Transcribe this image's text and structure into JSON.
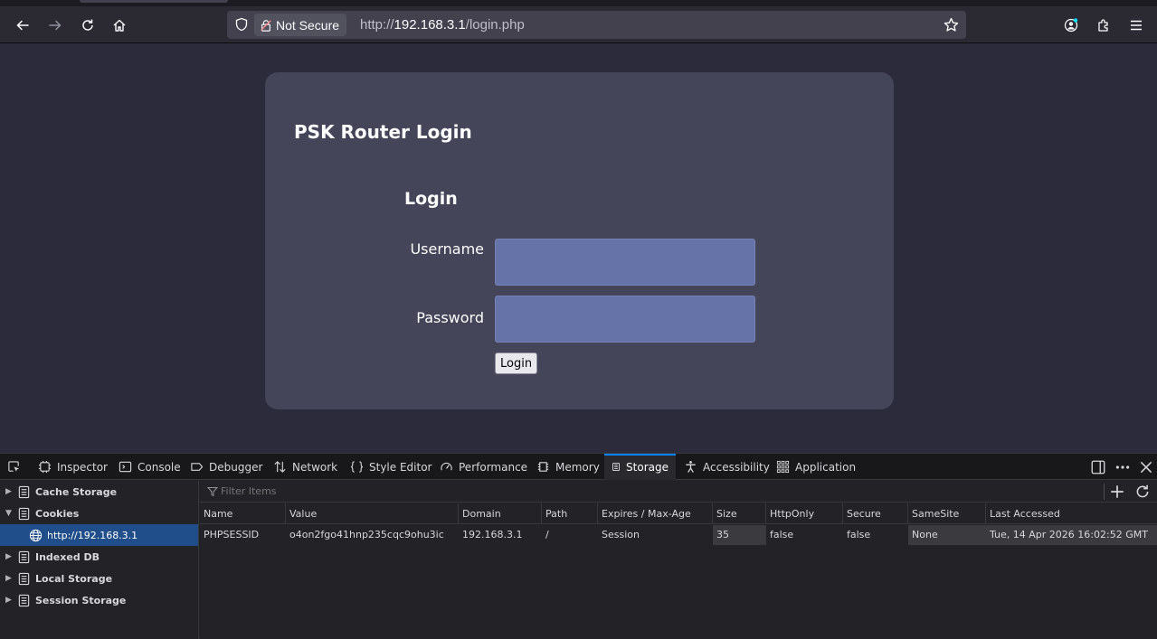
{
  "browser": {
    "security_label": "Not Secure",
    "url_prefix": "http://",
    "url_host": "192.168.3.1",
    "url_path": "/login.php"
  },
  "page": {
    "title": "PSK Router Login",
    "form_heading": "Login",
    "username_label": "Username",
    "password_label": "Password",
    "username_value": "",
    "password_value": "",
    "login_button": "Login"
  },
  "devtools": {
    "tabs": [
      "Inspector",
      "Console",
      "Debugger",
      "Network",
      "Style Editor",
      "Performance",
      "Memory",
      "Storage",
      "Accessibility",
      "Application"
    ],
    "selected_tab": "Storage",
    "sidebar": {
      "cache_storage": "Cache Storage",
      "cookies": "Cookies",
      "cookie_host": "http://192.168.3.1",
      "indexed_db": "Indexed DB",
      "local_storage": "Local Storage",
      "session_storage": "Session Storage"
    },
    "filter_placeholder": "Filter Items",
    "columns": [
      "Name",
      "Value",
      "Domain",
      "Path",
      "Expires / Max-Age",
      "Size",
      "HttpOnly",
      "Secure",
      "SameSite",
      "Last Accessed"
    ],
    "rows": [
      [
        "PHPSESSID",
        "o4on2fgo41hnp235cqc9ohu3ic",
        "192.168.3.1",
        "/",
        "Session",
        "35",
        "false",
        "false",
        "None",
        "Tue, 14 Apr 2026 16:02:52 GMT"
      ]
    ]
  }
}
